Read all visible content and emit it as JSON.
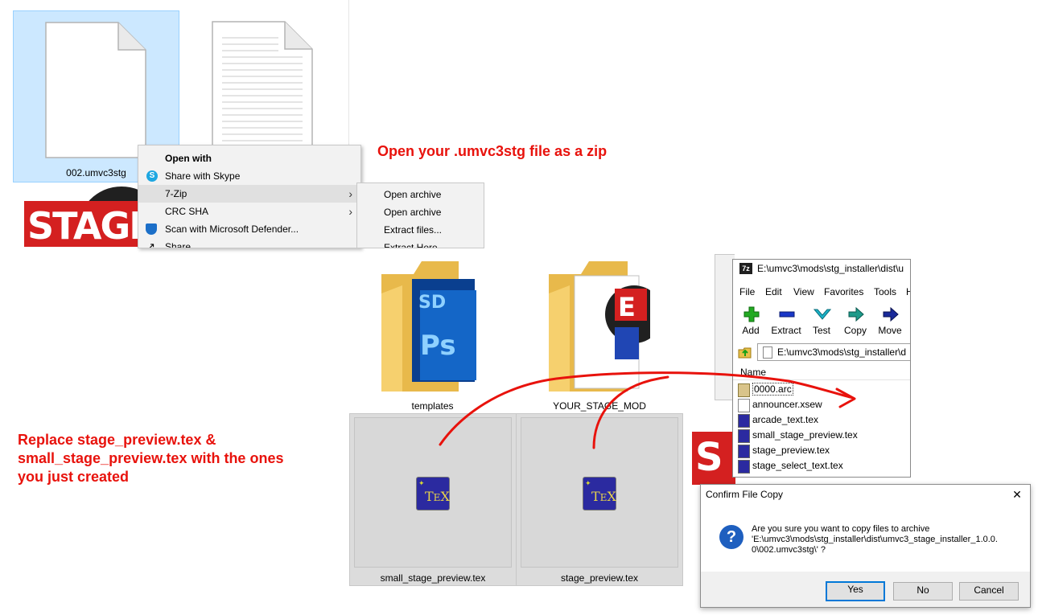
{
  "explorer": {
    "files": [
      {
        "name": "002.umvc3stg"
      },
      {
        "name": ""
      }
    ]
  },
  "context_menu": {
    "items": [
      {
        "label": "Open with",
        "bold": true
      },
      {
        "label": "Share with Skype"
      },
      {
        "label": "7-Zip",
        "submenu": true
      },
      {
        "label": "CRC SHA",
        "submenu": true
      },
      {
        "label": "Scan with Microsoft Defender..."
      },
      {
        "label": "Share"
      }
    ],
    "submenu": [
      {
        "label": "Open archive"
      },
      {
        "label": "Open archive"
      },
      {
        "label": "Extract files..."
      },
      {
        "label": "Extract Here"
      }
    ]
  },
  "logo_text": "STAGE",
  "annotations": {
    "top": "Open your .umvc3stg file as a zip",
    "left_line1": "Replace stage_preview.tex &",
    "left_line2": "small_stage_preview.tex with the ones",
    "left_line3": "you just created"
  },
  "folders": [
    {
      "name": "templates"
    },
    {
      "name": "YOUR_STAGE_MOD"
    }
  ],
  "tex_files": [
    {
      "name": "small_stage_preview.tex"
    },
    {
      "name": "stage_preview.tex"
    }
  ],
  "sevenzip": {
    "app_icon_text": "7z",
    "title": "E:\\umvc3\\mods\\stg_installer\\dist\\u",
    "menu": [
      "File",
      "Edit",
      "View",
      "Favorites",
      "Tools",
      "H"
    ],
    "toolbar": [
      {
        "label": "Add",
        "icon": "plus-icon",
        "color": "#22aa22"
      },
      {
        "label": "Extract",
        "icon": "minus-icon",
        "color": "#1a37c8"
      },
      {
        "label": "Test",
        "icon": "check-icon",
        "color": "#1bb3c9"
      },
      {
        "label": "Copy",
        "icon": "copy-arrow-icon",
        "color": "#1e9a8a"
      },
      {
        "label": "Move",
        "icon": "move-arrow-icon",
        "color": "#1a2a9a"
      }
    ],
    "address": "E:\\umvc3\\mods\\stg_installer\\d",
    "column_name": "Name",
    "files": [
      {
        "name": "0000.arc",
        "icon": "arc-file-icon"
      },
      {
        "name": "announcer.xsew",
        "icon": "blank-file-icon"
      },
      {
        "name": "arcade_text.tex",
        "icon": "tex-file-icon"
      },
      {
        "name": "small_stage_preview.tex",
        "icon": "tex-file-icon"
      },
      {
        "name": "stage_preview.tex",
        "icon": "tex-file-icon"
      },
      {
        "name": "stage_select_text.tex",
        "icon": "tex-file-icon"
      }
    ]
  },
  "dialog": {
    "title": "Confirm File Copy",
    "close": "✕",
    "message_line1": "Are you sure you want to copy files to archive",
    "message_line2": "'E:\\umvc3\\mods\\stg_installer\\dist\\umvc3_stage_installer_1.0.0.",
    "message_line3": "0\\002.umvc3stg\\' ?",
    "icon_glyph": "?",
    "buttons": {
      "yes": "Yes",
      "no": "No",
      "cancel": "Cancel"
    }
  },
  "colors": {
    "annotation_red": "#e8120c",
    "selection_blue": "#cce8ff",
    "dialog_accent": "#0078d7"
  }
}
